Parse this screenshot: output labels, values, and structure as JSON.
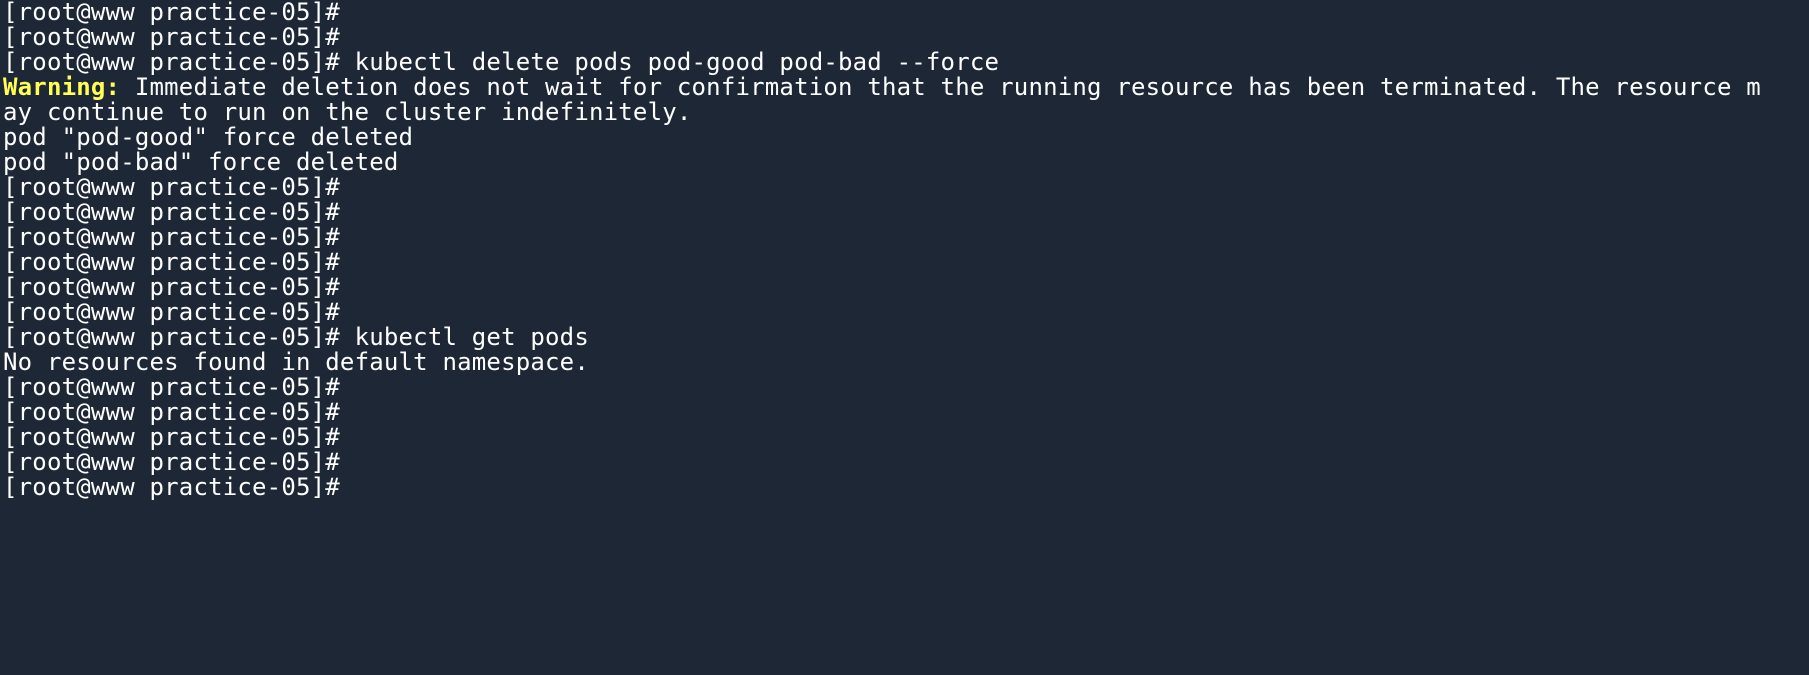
{
  "colors": {
    "background": "#1e2736",
    "foreground": "#ffffff",
    "warning": "#ffff55"
  },
  "terminal": {
    "lines": [
      {
        "prompt": "[root@www practice-05]#",
        "text": ""
      },
      {
        "prompt": "[root@www practice-05]#",
        "text": ""
      },
      {
        "prompt": "[root@www practice-05]#",
        "text": " kubectl delete pods pod-good pod-bad --force"
      },
      {
        "warning": "Warning:",
        "text": " Immediate deletion does not wait for confirmation that the running resource has been terminated. The resource m"
      },
      {
        "text": "ay continue to run on the cluster indefinitely."
      },
      {
        "text": "pod \"pod-good\" force deleted"
      },
      {
        "text": "pod \"pod-bad\" force deleted"
      },
      {
        "prompt": "[root@www practice-05]#",
        "text": ""
      },
      {
        "prompt": "[root@www practice-05]#",
        "text": ""
      },
      {
        "prompt": "[root@www practice-05]#",
        "text": ""
      },
      {
        "prompt": "[root@www practice-05]#",
        "text": ""
      },
      {
        "prompt": "[root@www practice-05]#",
        "text": ""
      },
      {
        "prompt": "[root@www practice-05]#",
        "text": ""
      },
      {
        "prompt": "[root@www practice-05]#",
        "text": " kubectl get pods"
      },
      {
        "text": "No resources found in default namespace."
      },
      {
        "prompt": "[root@www practice-05]#",
        "text": ""
      },
      {
        "prompt": "[root@www practice-05]#",
        "text": ""
      },
      {
        "prompt": "[root@www practice-05]#",
        "text": ""
      },
      {
        "prompt": "[root@www practice-05]#",
        "text": ""
      },
      {
        "prompt": "[root@www practice-05]#",
        "text": ""
      }
    ]
  }
}
